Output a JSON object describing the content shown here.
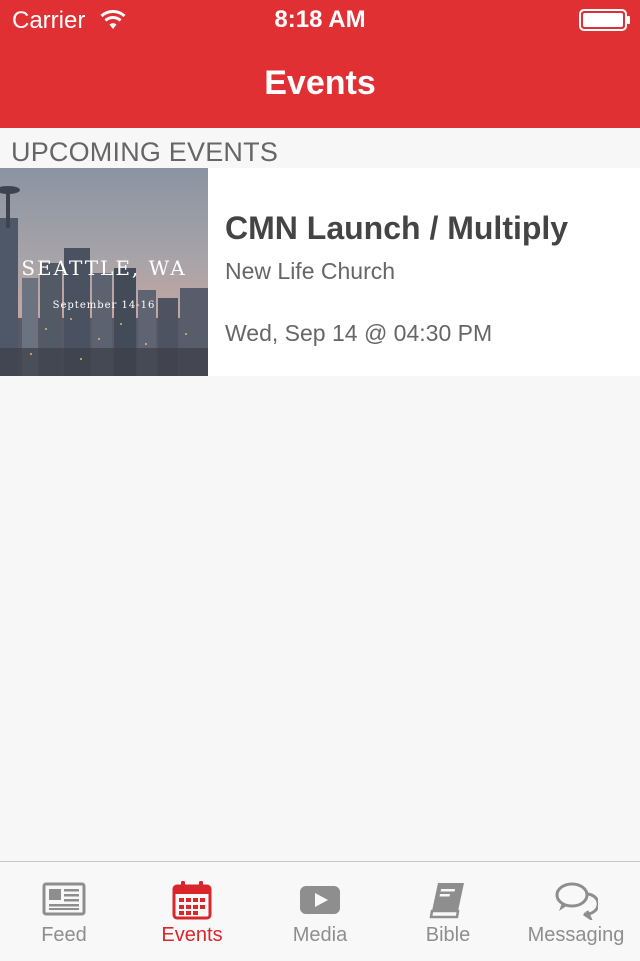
{
  "status_bar": {
    "carrier": "Carrier",
    "time": "8:18 AM"
  },
  "nav": {
    "title": "Events"
  },
  "section": {
    "header": "UPCOMING EVENTS"
  },
  "events": [
    {
      "thumb_city": "SEATTLE, WA",
      "thumb_dates": "September 14-16",
      "title": "CMN Launch / Multiply",
      "venue": "New Life Church",
      "datetime": "Wed, Sep 14 @ 04:30 PM"
    }
  ],
  "tabs": [
    {
      "label": "Feed",
      "icon": "newspaper-icon",
      "active": false
    },
    {
      "label": "Events",
      "icon": "calendar-icon",
      "active": true
    },
    {
      "label": "Media",
      "icon": "play-icon",
      "active": false
    },
    {
      "label": "Bible",
      "icon": "book-icon",
      "active": false
    },
    {
      "label": "Messaging",
      "icon": "chat-bubbles-icon",
      "active": false
    }
  ],
  "colors": {
    "accent": "#e03034",
    "tab_active": "#d9262b",
    "tab_inactive": "#8e8e8e"
  }
}
